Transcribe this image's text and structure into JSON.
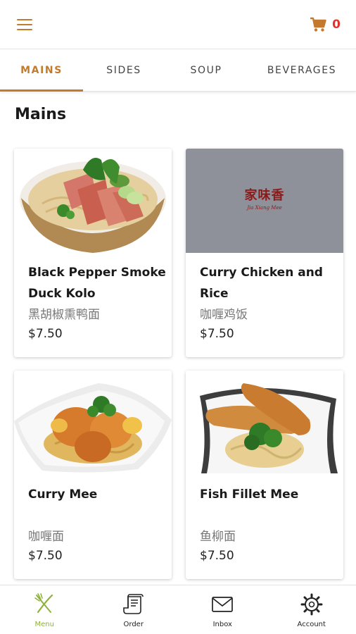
{
  "header": {
    "cart_count": "0"
  },
  "tabs": [
    {
      "label": "MAINS",
      "active": true
    },
    {
      "label": "SIDES",
      "active": false
    },
    {
      "label": "SOUP",
      "active": false
    },
    {
      "label": "BEVERAGES",
      "active": false
    }
  ],
  "section_title": "Mains",
  "items": [
    {
      "name": "Black Pepper Smoke Duck Kolo",
      "name_cn": "黑胡椒熏鸭面",
      "price": "$7.50",
      "image": "duck-noodle-photo"
    },
    {
      "name": "Curry Chicken and Rice",
      "name_cn": "咖喱鸡饭",
      "price": "$7.50",
      "image": "brand-logo-placeholder",
      "logo_cn": "家味香",
      "logo_en": "Jia Xiang Mee"
    },
    {
      "name": "Curry Mee",
      "name_cn": "咖喱面",
      "price": "$7.50",
      "image": "curry-mee-photo"
    },
    {
      "name": "Fish Fillet Mee",
      "name_cn": "鱼柳面",
      "price": "$7.50",
      "image": "fish-fillet-photo"
    }
  ],
  "bottom_nav": [
    {
      "label": "Menu",
      "icon": "fork-knife-icon",
      "active": true
    },
    {
      "label": "Order",
      "icon": "receipt-icon",
      "active": false
    },
    {
      "label": "Inbox",
      "icon": "envelope-icon",
      "active": false
    },
    {
      "label": "Account",
      "icon": "gear-icon",
      "active": false
    }
  ],
  "colors": {
    "accent": "#c47a2c",
    "cart_badge": "#e2322b",
    "nav_active": "#8db23a",
    "placeholder_bg": "#8e9199"
  }
}
